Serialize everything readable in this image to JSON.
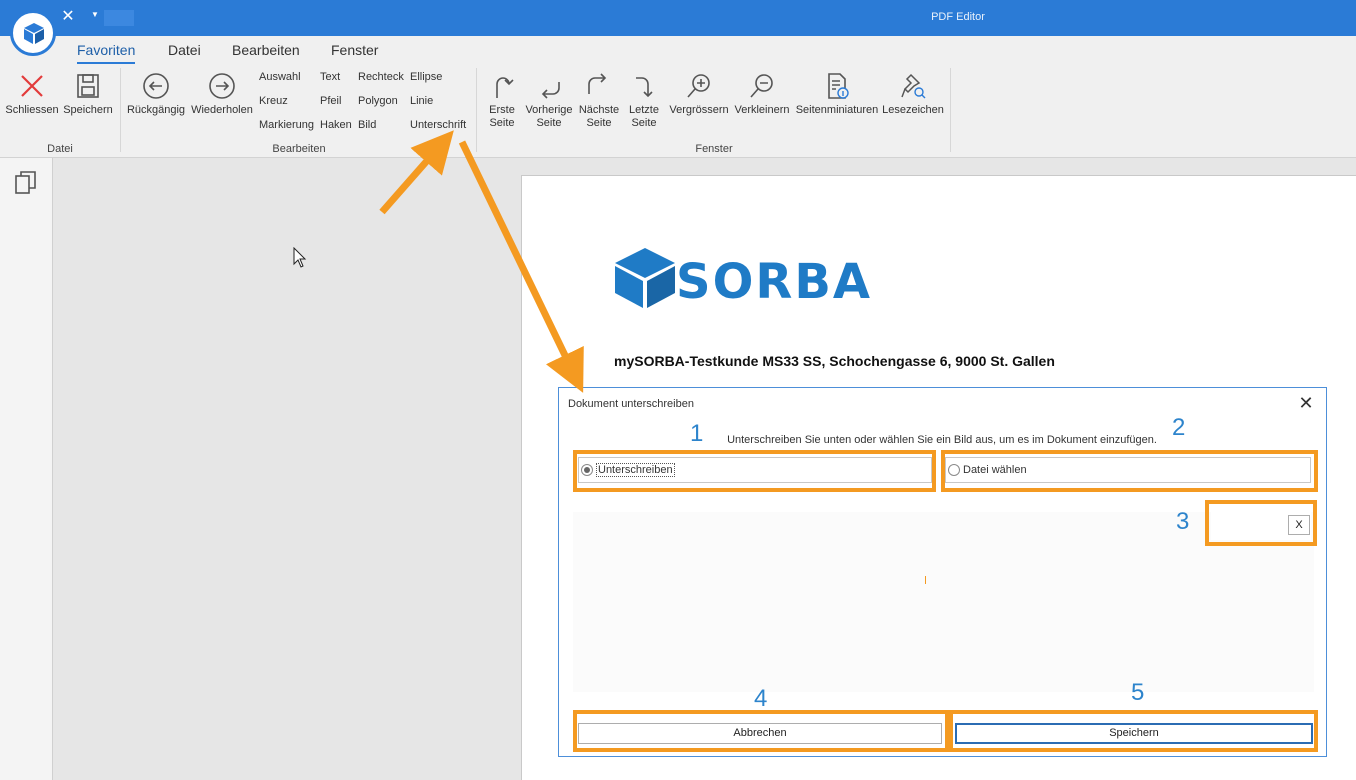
{
  "window": {
    "title": "PDF Editor"
  },
  "quick_access": {
    "close_icon": "close-icon",
    "dropdown_icon": "dropdown-arrow-icon"
  },
  "ribbon": {
    "tabs": [
      {
        "label": "Favoriten",
        "active": true
      },
      {
        "label": "Datei"
      },
      {
        "label": "Bearbeiten"
      },
      {
        "label": "Fenster"
      }
    ],
    "groups": {
      "datei": {
        "label": "Datei",
        "close": "Schliessen",
        "save": "Speichern"
      },
      "bearbeiten": {
        "label": "Bearbeiten",
        "undo": "Rückgängig",
        "redo": "Wiederholen",
        "col1": [
          "Auswahl",
          "Kreuz",
          "Markierung"
        ],
        "col2": [
          "Text",
          "Pfeil",
          "Haken"
        ],
        "col3": [
          "Rechteck",
          "Polygon",
          "Bild"
        ],
        "col4": [
          "Ellipse",
          "Linie",
          "Unterschrift"
        ]
      },
      "fenster": {
        "label": "Fenster",
        "first_line1": "Erste",
        "first_line2": "Seite",
        "prev_line1": "Vorherige",
        "prev_line2": "Seite",
        "next_line1": "Nächste",
        "next_line2": "Seite",
        "last_line1": "Letzte",
        "last_line2": "Seite",
        "zoom_in": "Vergrössern",
        "zoom_out": "Verkleinern",
        "thumbnails": "Seitenminiaturen",
        "bookmarks": "Lesezeichen"
      }
    }
  },
  "document": {
    "logo_text": "SORBA",
    "address": "mySORBA-Testkunde MS33 SS, Schochengasse 6, 9000  St. Gallen"
  },
  "dialog": {
    "title": "Dokument unterschreiben",
    "instruction": "Unterschreiben Sie unten oder wählen Sie ein Bild aus, um es im Dokument einzufügen.",
    "option_sign": "Unterschreiben",
    "option_file": "Datei wählen",
    "clear_label": "X",
    "cancel": "Abbrechen",
    "save": "Speichern",
    "callouts": [
      "1",
      "2",
      "3",
      "4",
      "5"
    ]
  },
  "colors": {
    "accent": "#2b7bd6",
    "highlight": "#f49a21",
    "callout": "#2d84cc",
    "logo": "#1f7bc6"
  }
}
